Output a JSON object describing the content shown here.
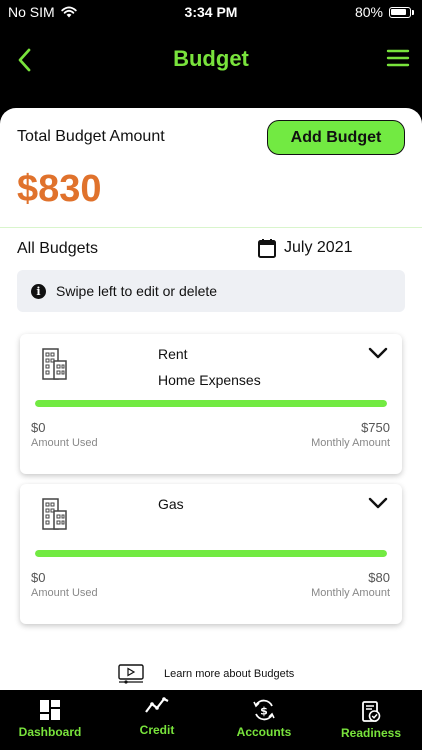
{
  "status": {
    "carrier": "No SIM",
    "time": "3:34 PM",
    "battery": "80%",
    "battery_level": 0.8
  },
  "header": {
    "title": "Budget",
    "back_icon": "chevron-left-icon",
    "menu_icon": "hamburger-menu-icon"
  },
  "summary": {
    "total_label": "Total Budget Amount",
    "total_amount": "$830",
    "add_button": "Add Budget"
  },
  "list": {
    "heading": "All Budgets",
    "month": "July 2021",
    "info": "Swipe left to edit or delete"
  },
  "budgets": [
    {
      "name": "Rent",
      "category": "Home Expenses",
      "used": "$0",
      "used_label": "Amount Used",
      "monthly": "$750",
      "monthly_label": "Monthly Amount",
      "progress": 1.0
    },
    {
      "name": "Gas",
      "category": "",
      "used": "$0",
      "used_label": "Amount Used",
      "monthly": "$80",
      "monthly_label": "Monthly Amount",
      "progress": 1.0
    }
  ],
  "learn_more": "Learn more about Budgets",
  "nav": [
    {
      "label": "Dashboard",
      "icon": "dashboard-icon"
    },
    {
      "label": "Credit",
      "icon": "credit-trend-icon"
    },
    {
      "label": "Accounts",
      "icon": "accounts-icon"
    },
    {
      "label": "Readiness",
      "icon": "readiness-icon"
    }
  ],
  "colors": {
    "accent": "#79e33c",
    "button": "#72ea42",
    "amount": "#e0722c"
  }
}
